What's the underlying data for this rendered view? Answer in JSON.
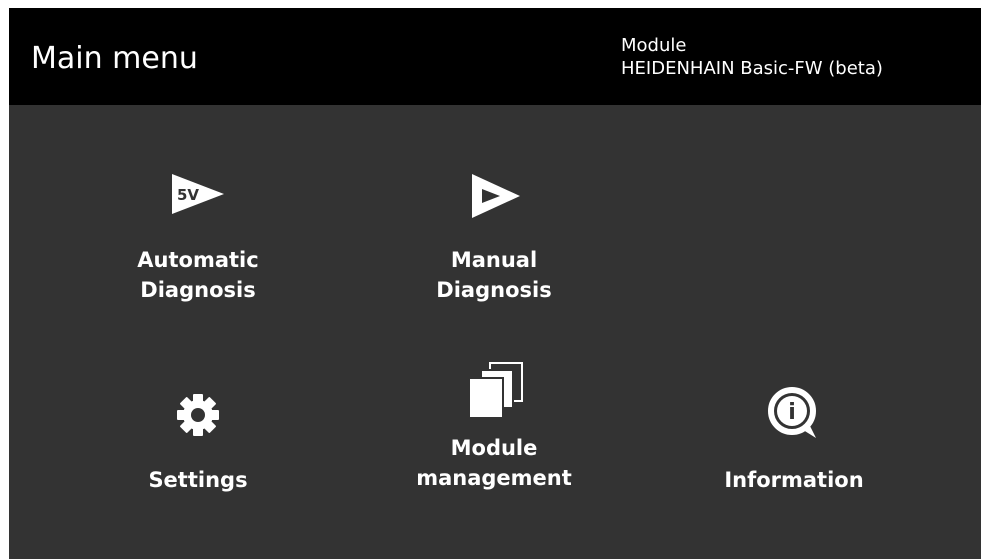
{
  "header": {
    "title": "Main menu",
    "module_caption": "Module",
    "module_name": "HEIDENHAIN Basic-FW (beta)"
  },
  "menu": {
    "automatic": {
      "icon": "play-5v-icon",
      "line1": "Automatic",
      "line2": "Diagnosis",
      "badge": "5V"
    },
    "manual": {
      "icon": "play-outline-icon",
      "line1": "Manual",
      "line2": "Diagnosis"
    },
    "settings": {
      "icon": "gear-icon",
      "line1": "Settings"
    },
    "module_management": {
      "icon": "windows-stack-icon",
      "line1": "Module",
      "line2": "management"
    },
    "information": {
      "icon": "info-speech-bubble-icon",
      "line1": "Information",
      "glyph": "i"
    }
  },
  "colors": {
    "header_bg": "#000000",
    "screen_bg": "#333333",
    "text": "#ffffff"
  }
}
